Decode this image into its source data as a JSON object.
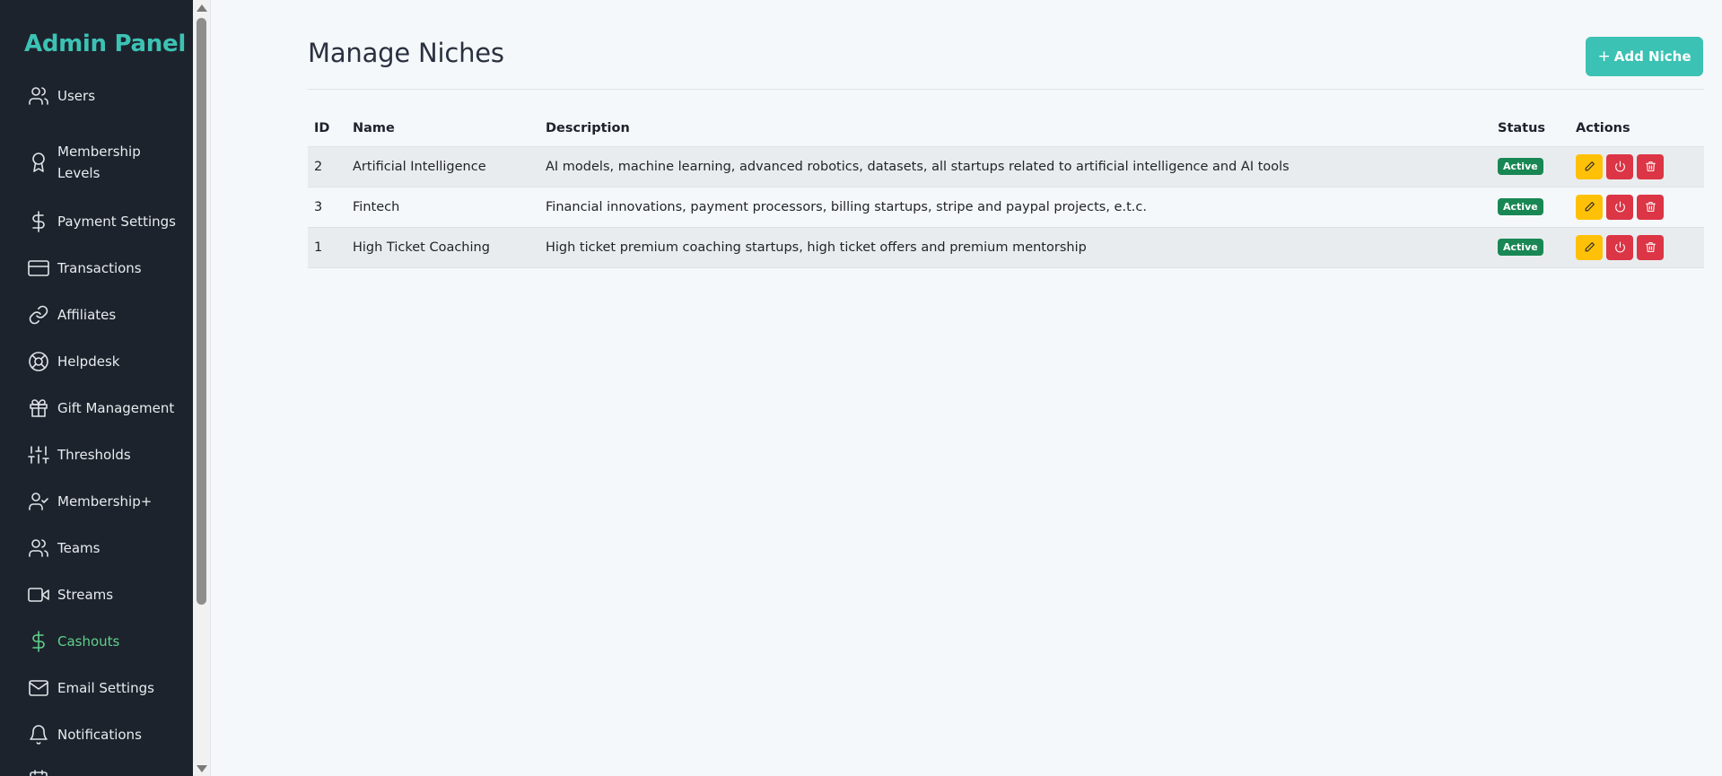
{
  "sidebar": {
    "brand": "Admin Panel",
    "items": [
      {
        "label": "Users",
        "icon": "users-icon"
      },
      {
        "label": "Membership Levels",
        "icon": "award-icon"
      },
      {
        "label": "Payment Settings",
        "icon": "dollar-icon"
      },
      {
        "label": "Transactions",
        "icon": "credit-card-icon"
      },
      {
        "label": "Affiliates",
        "icon": "link-icon"
      },
      {
        "label": "Helpdesk",
        "icon": "lifebuoy-icon"
      },
      {
        "label": "Gift Management",
        "icon": "gift-icon"
      },
      {
        "label": "Thresholds",
        "icon": "sliders-icon"
      },
      {
        "label": "Membership+",
        "icon": "user-check-icon"
      },
      {
        "label": "Teams",
        "icon": "users-icon"
      },
      {
        "label": "Streams",
        "icon": "video-icon"
      },
      {
        "label": "Cashouts",
        "icon": "dollar-icon",
        "active": true
      },
      {
        "label": "Email Settings",
        "icon": "mail-icon"
      },
      {
        "label": "Notifications",
        "icon": "bell-icon"
      }
    ]
  },
  "header": {
    "title": "Manage Niches",
    "add_label": "Add Niche",
    "add_icon": "plus-icon"
  },
  "table": {
    "columns": [
      "ID",
      "Name",
      "Description",
      "Status",
      "Actions"
    ],
    "rows": [
      {
        "id": "2",
        "name": "Artificial Intelligence",
        "description": "AI models, machine learning, advanced robotics, datasets, all startups related to artificial intelligence and AI tools",
        "status": "Active"
      },
      {
        "id": "3",
        "name": "Fintech",
        "description": "Financial innovations, payment processors, billing startups, stripe and paypal projects, e.t.c.",
        "status": "Active"
      },
      {
        "id": "1",
        "name": "High Ticket Coaching",
        "description": "High ticket premium coaching startups, high ticket offers and premium mentorship",
        "status": "Active"
      }
    ]
  },
  "colors": {
    "accent": "#3cc2b4",
    "sidebar_bg": "#1d232d",
    "active_nav": "#5fd18a",
    "status_active": "#198754",
    "edit_button": "#ffc107",
    "danger_button": "#dc3545"
  }
}
